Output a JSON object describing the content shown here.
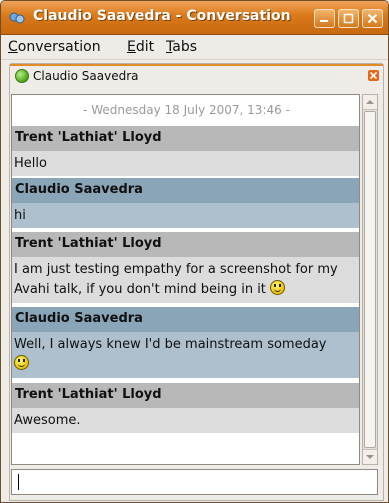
{
  "window": {
    "title": "Claudio Saavedra - Conversation",
    "controls": {
      "minimize": "minimize-icon",
      "maximize": "maximize-icon",
      "close": "close-icon"
    }
  },
  "menu": {
    "conversation": {
      "mnemonic": "C",
      "rest": "onversation"
    },
    "edit": {
      "mnemonic": "E",
      "rest": "dit"
    },
    "tabs": {
      "mnemonic": "T",
      "rest": "abs"
    }
  },
  "tab": {
    "label": "Claudio Saavedra",
    "status_color": "#4ea41a",
    "accent": "#e08a2a"
  },
  "conversation": {
    "date": "- Wednesday 18 July 2007, 13:46 -",
    "messages": [
      {
        "sender": "Trent 'Lathiat' Lloyd",
        "text": "Hello"
      },
      {
        "sender": "Claudio Saavedra",
        "text": "hi"
      },
      {
        "sender": "Trent 'Lathiat' Lloyd",
        "text": "I am just testing empathy for a screenshot for my Avahi talk, if you don't mind being in it"
      },
      {
        "sender": "Claudio Saavedra",
        "text": "Well, I always knew I'd be mainstream someday"
      },
      {
        "sender": "Trent 'Lathiat' Lloyd",
        "text": "Awesome."
      }
    ],
    "colors": {
      "remote_header": "#b8b8b8",
      "remote_body": "#dcdcdc",
      "self_header": "#8aa4b8",
      "self_body": "#aec0cd"
    }
  },
  "input": {
    "value": ""
  }
}
